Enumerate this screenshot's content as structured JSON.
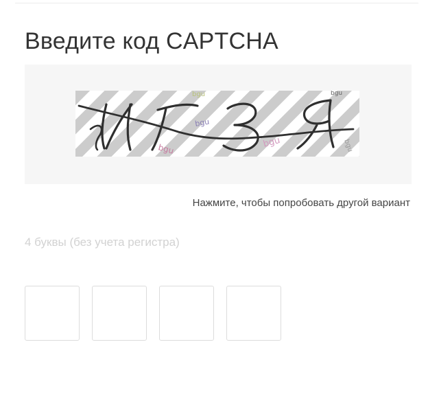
{
  "header": {
    "title": "Введите код CAPTCHA"
  },
  "captcha": {
    "image_text": "ИГЗЯ",
    "refresh_label": "Нажмите, чтобы попробовать другой вариант"
  },
  "hint": {
    "text": "4 буквы (без учета регистра)"
  },
  "code_inputs": [
    {
      "value": ""
    },
    {
      "value": ""
    },
    {
      "value": ""
    },
    {
      "value": ""
    }
  ],
  "colors": {
    "title": "#333333",
    "hint": "#d2d2d2",
    "captcha_background": "#f6f6f6",
    "captcha_stripes": "#c8c8c8",
    "captcha_ink": "#333333",
    "input_border": "#dcdcdc"
  }
}
